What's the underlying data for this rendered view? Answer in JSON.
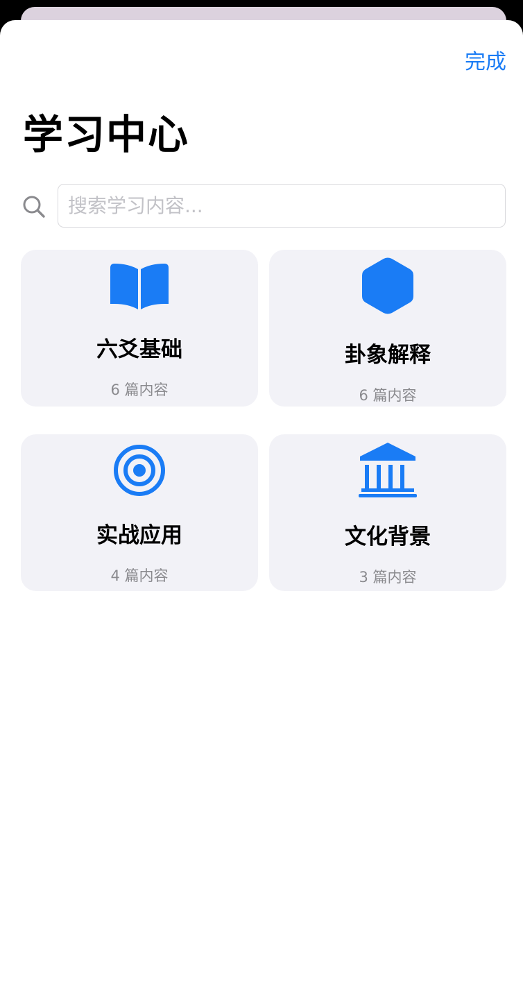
{
  "header": {
    "done_label": "完成",
    "title": "学习中心"
  },
  "search": {
    "placeholder": "搜索学习内容...",
    "value": "",
    "icon": "magnifying-glass"
  },
  "categories": [
    {
      "title": "六爻基础",
      "count": "6 篇内容",
      "icon": "book"
    },
    {
      "title": "卦象解释",
      "count": "6 篇内容",
      "icon": "hexagon"
    },
    {
      "title": "实战应用",
      "count": "4 篇内容",
      "icon": "target"
    },
    {
      "title": "文化背景",
      "count": "3 篇内容",
      "icon": "building-columns"
    }
  ],
  "colors": {
    "accent": "#1a7cf5",
    "card_bg": "#f2f2f7",
    "secondary_text": "#8a8a8e"
  }
}
